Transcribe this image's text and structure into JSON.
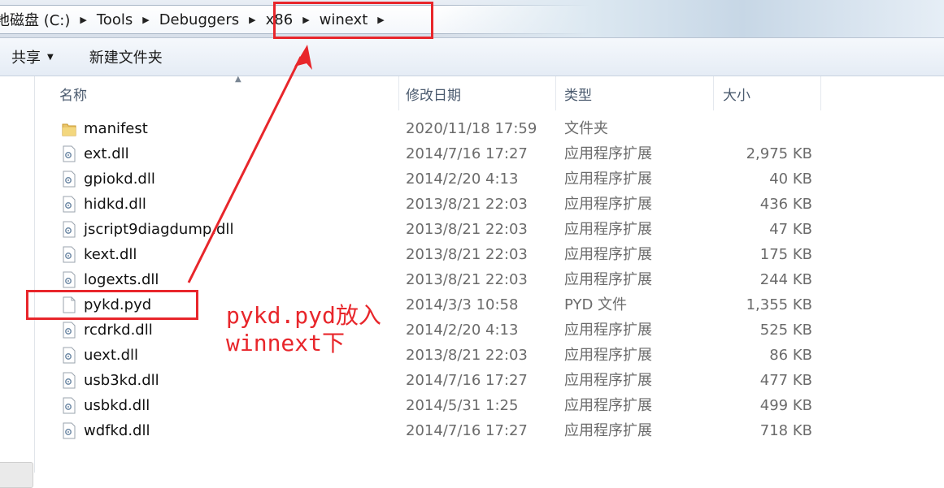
{
  "address_bar": {
    "crumbs": [
      "地磁盘 (C:)",
      "Tools",
      "Debuggers",
      "x86",
      "winext"
    ]
  },
  "toolbar": {
    "share_label": "共享",
    "new_folder_label": "新建文件夹"
  },
  "columns": {
    "name": "名称",
    "date": "修改日期",
    "type": "类型",
    "size": "大小"
  },
  "files": [
    {
      "name": "manifest",
      "date": "2020/11/18 17:59",
      "type": "文件夹",
      "size": "",
      "icon": "folder-icon"
    },
    {
      "name": "ext.dll",
      "date": "2014/7/16 17:27",
      "type": "应用程序扩展",
      "size": "2,975 KB",
      "icon": "dll-file-icon"
    },
    {
      "name": "gpiokd.dll",
      "date": "2014/2/20 4:13",
      "type": "应用程序扩展",
      "size": "40 KB",
      "icon": "dll-file-icon"
    },
    {
      "name": "hidkd.dll",
      "date": "2013/8/21 22:03",
      "type": "应用程序扩展",
      "size": "436 KB",
      "icon": "dll-file-icon"
    },
    {
      "name": "jscript9diagdump.dll",
      "date": "2013/8/21 22:03",
      "type": "应用程序扩展",
      "size": "47 KB",
      "icon": "dll-file-icon"
    },
    {
      "name": "kext.dll",
      "date": "2013/8/21 22:03",
      "type": "应用程序扩展",
      "size": "175 KB",
      "icon": "dll-file-icon"
    },
    {
      "name": "logexts.dll",
      "date": "2013/8/21 22:03",
      "type": "应用程序扩展",
      "size": "244 KB",
      "icon": "dll-file-icon"
    },
    {
      "name": "pykd.pyd",
      "date": "2014/3/3 10:58",
      "type": "PYD 文件",
      "size": "1,355 KB",
      "icon": "blank-file-icon"
    },
    {
      "name": "rcdrkd.dll",
      "date": "2014/2/20 4:13",
      "type": "应用程序扩展",
      "size": "525 KB",
      "icon": "dll-file-icon"
    },
    {
      "name": "uext.dll",
      "date": "2013/8/21 22:03",
      "type": "应用程序扩展",
      "size": "86 KB",
      "icon": "dll-file-icon"
    },
    {
      "name": "usb3kd.dll",
      "date": "2014/7/16 17:27",
      "type": "应用程序扩展",
      "size": "477 KB",
      "icon": "dll-file-icon"
    },
    {
      "name": "usbkd.dll",
      "date": "2014/5/31 1:25",
      "type": "应用程序扩展",
      "size": "499 KB",
      "icon": "dll-file-icon"
    },
    {
      "name": "wdfkd.dll",
      "date": "2014/7/16 17:27",
      "type": "应用程序扩展",
      "size": "718 KB",
      "icon": "dll-file-icon"
    }
  ],
  "annotation": {
    "line1": "pykd.pyd放入",
    "line2": "winnext下",
    "color": "#e8262b"
  },
  "colors": {
    "annotation_red": "#e8262b",
    "secondary_text": "#6b6b6b",
    "header_text": "#4a5a6e"
  }
}
